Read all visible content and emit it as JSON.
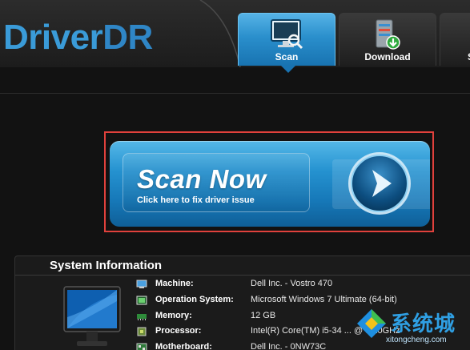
{
  "app": {
    "logo_part1": "Driver",
    "logo_part2": "DR"
  },
  "tabs": [
    {
      "label": "Scan",
      "icon": "monitor-scan-icon",
      "active": true
    },
    {
      "label": "Download",
      "icon": "server-download-icon",
      "active": false
    },
    {
      "label": "S",
      "icon": "tab-icon",
      "active": false
    }
  ],
  "scan": {
    "title": "Scan Now",
    "subtitle": "Click here to fix driver issue",
    "arrow_icon": "arrow-right-icon",
    "highlight_color": "#e0413c"
  },
  "system_info": {
    "title": "System Information",
    "rows": [
      {
        "key": "Machine:",
        "value": "Dell Inc. - Vostro 470",
        "icon": "computer-icon"
      },
      {
        "key": "Operation System:",
        "value": "Microsoft Windows 7 Ultimate  (64-bit)",
        "icon": "window-icon"
      },
      {
        "key": "Memory:",
        "value": "12 GB",
        "icon": "memory-icon"
      },
      {
        "key": "Processor:",
        "value": "Intel(R) Core(TM) i5-34 ... @ 3.10GHz",
        "icon": "cpu-icon"
      },
      {
        "key": "Motherboard:",
        "value": "Dell Inc. - 0NW73C",
        "icon": "motherboard-icon"
      }
    ]
  },
  "watermark": {
    "text": "系统城",
    "url": "xitongcheng.com"
  },
  "colors": {
    "accent": "#2a8fcc",
    "logo_blue": "#3a9bd8",
    "background": "#121212"
  }
}
